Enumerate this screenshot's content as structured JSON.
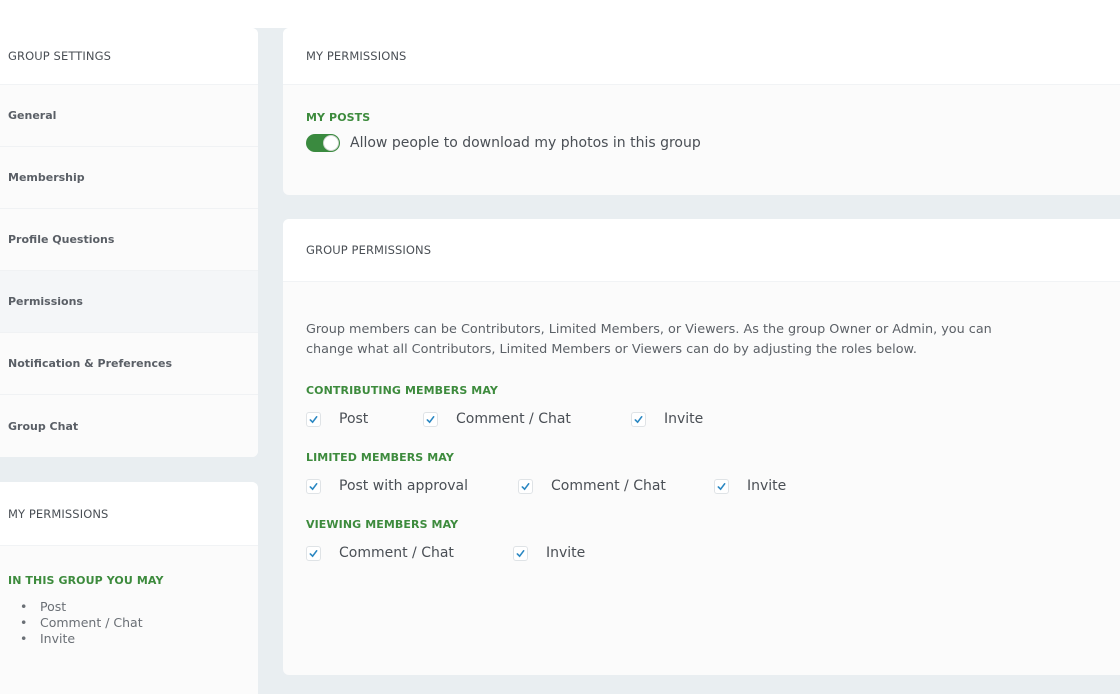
{
  "sidebar": {
    "settings_title": "GROUP SETTINGS",
    "items": [
      {
        "label": "General",
        "active": false
      },
      {
        "label": "Membership",
        "active": false
      },
      {
        "label": "Profile Questions",
        "active": false
      },
      {
        "label": "Permissions",
        "active": true
      },
      {
        "label": "Notification & Preferences",
        "active": false
      },
      {
        "label": "Group Chat",
        "active": false
      }
    ],
    "my_permissions": {
      "title": "MY PERMISSIONS",
      "subtitle": "IN THIS GROUP YOU MAY",
      "bullet": "•",
      "items": [
        "Post",
        "Comment / Chat",
        "Invite"
      ]
    }
  },
  "main": {
    "my_permissions_card": {
      "title": "MY PERMISSIONS",
      "section_label": "MY POSTS",
      "toggle": {
        "label": "Allow people to download my photos in this group",
        "on": true
      }
    },
    "group_permissions_card": {
      "title": "GROUP PERMISSIONS",
      "description_line1": "Group members can be Contributors, Limited Members, or Viewers. As the group Owner or Admin, you can",
      "description_line2": "change what all Contributors, Limited Members or Viewers can do by adjusting the roles below.",
      "groups": [
        {
          "label": "CONTRIBUTING MEMBERS MAY",
          "options": [
            {
              "label": "Post",
              "checked": true
            },
            {
              "label": "Comment / Chat",
              "checked": true
            },
            {
              "label": "Invite",
              "checked": true
            }
          ]
        },
        {
          "label": "LIMITED MEMBERS MAY",
          "options": [
            {
              "label": "Post with approval",
              "checked": true
            },
            {
              "label": "Comment / Chat",
              "checked": true
            },
            {
              "label": "Invite",
              "checked": true
            }
          ]
        },
        {
          "label": "VIEWING MEMBERS MAY",
          "options": [
            {
              "label": "Comment / Chat",
              "checked": true
            },
            {
              "label": "Invite",
              "checked": true
            }
          ]
        }
      ]
    }
  },
  "colors": {
    "accent_green": "#3d8b3d",
    "toggle_green": "#3a8a3f",
    "check_blue": "#2a87c2",
    "background": "#e9eef1"
  }
}
